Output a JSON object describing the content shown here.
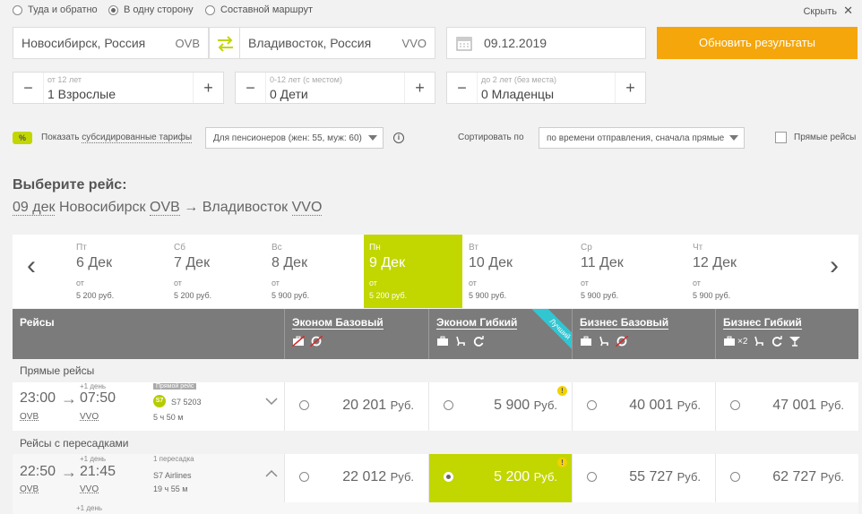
{
  "trip_type": {
    "options": [
      "Туда и обратно",
      "В одну сторону",
      "Составной маршрут"
    ],
    "selected": 1,
    "hide_link": "Скрыть"
  },
  "route": {
    "from_city": "Новосибирск, Россия",
    "from_code": "OVB",
    "to_city": "Владивосток, Россия",
    "to_code": "VVO",
    "date": "09.12.2019",
    "submit_label": "Обновить результаты"
  },
  "passengers": [
    {
      "hint": "от 12 лет",
      "value": "1 Взрослые"
    },
    {
      "hint": "0-12 лет (с местом)",
      "value": "0 Дети"
    },
    {
      "hint": "до 2 лет (без места)",
      "value": "0 Младенцы"
    }
  ],
  "filters": {
    "badge": "%",
    "subsidized_prefix": "Показать ",
    "subsidized_link": "субсидированные тарифы",
    "pensioner_select": "Для пенсионеров (жен: 55, муж: 60)",
    "info_icon": "i",
    "sort_label": "Сортировать по",
    "sort_select": "по времени отправления, сначала прямые",
    "direct_label": "Прямые рейсы"
  },
  "heading": {
    "title": "Выберите рейс:",
    "date": "09 дек",
    "from": "Новосибирск",
    "from_code": "OVB",
    "arrow": "→",
    "to": "Владивосток",
    "to_code": "VVO"
  },
  "date_strip": {
    "prev": "‹",
    "next": "›",
    "from_label": "от",
    "days": [
      {
        "dow": "Пт",
        "date": "6 Дек",
        "price": "5 200 руб."
      },
      {
        "dow": "Сб",
        "date": "7 Дек",
        "price": "5 200 руб."
      },
      {
        "dow": "Вс",
        "date": "8 Дек",
        "price": "5 900 руб."
      },
      {
        "dow": "Пн",
        "date": "9 Дек",
        "price": "5 200 руб."
      },
      {
        "dow": "Вт",
        "date": "10 Дек",
        "price": "5 900 руб."
      },
      {
        "dow": "Ср",
        "date": "11 Дек",
        "price": "5 900 руб."
      },
      {
        "dow": "Чт",
        "date": "12 Дек",
        "price": "5 900 руб."
      }
    ],
    "active_index": 3
  },
  "table": {
    "flights_header": "Рейсы",
    "fare_headers": [
      "Эконом Базовый",
      "Эконом Гибкий",
      "Бизнес Базовый",
      "Бизнес Гибкий"
    ],
    "best_ribbon": "Лучший",
    "baggage_x2": "×2",
    "direct_section": "Прямые рейсы",
    "connecting_section": "Рейсы с пересадками",
    "currency": "Руб.",
    "direct_flight": {
      "dep_time": "23:00",
      "arr_time": "07:50",
      "dep_code": "OVB",
      "arr_code": "VVO",
      "next_day": "+1 день",
      "badge": "Прямой рейс",
      "flight_no": "S7 5203",
      "duration": "5 ч 50 м",
      "prices": [
        "20 201",
        "5 900",
        "40 001",
        "47 001"
      ]
    },
    "connecting_flight": {
      "dep_time": "22:50",
      "arr_time": "21:45",
      "dep_code": "OVB",
      "arr_code": "VVO",
      "next_day": "+1 день",
      "stops": "1 пересадка",
      "airline": "S7 Airlines",
      "duration": "19 ч 55 м",
      "prices": [
        "22 012",
        "5 200",
        "55 727",
        "62 727"
      ],
      "footer_next_day": "+1 день"
    }
  },
  "colors": {
    "accent_orange": "#f5a60a",
    "accent_green": "#c2d600",
    "best_ribbon": "#32c5d2",
    "header_gray": "#7b7b7b"
  }
}
